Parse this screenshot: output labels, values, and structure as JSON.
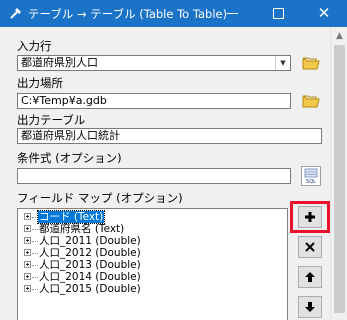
{
  "window": {
    "title": "テーブル → テーブル (Table To Table)",
    "title_bar_color": "#1a73c7",
    "minimize_icon": "minimize-icon",
    "maximize_icon": "maximize-icon",
    "close_glyph": "✕"
  },
  "form": {
    "input_rows_label": "入力行",
    "input_rows_value": "都道府県別人口",
    "output_location_label": "出力場所",
    "output_location_value": "C:¥Temp¥a.gdb",
    "output_table_label": "出力テーブル",
    "output_table_value": "都道府県別人口統計",
    "expression_label": "条件式 (オプション)",
    "expression_value": "",
    "field_map_label": "フィールド マップ (オプション)"
  },
  "field_map": {
    "items": [
      {
        "label": "コード (Text)",
        "selected": true
      },
      {
        "label": "都道府県名 (Text)",
        "selected": false
      },
      {
        "label": "人口_2011 (Double)",
        "selected": false
      },
      {
        "label": "人口_2012 (Double)",
        "selected": false
      },
      {
        "label": "人口_2013 (Double)",
        "selected": false
      },
      {
        "label": "人口_2014 (Double)",
        "selected": false
      },
      {
        "label": "人口_2015 (Double)",
        "selected": false
      }
    ]
  },
  "side_buttons": {
    "add_icon": "plus-icon",
    "remove_icon": "x-icon",
    "up_icon": "arrow-up-icon",
    "down_icon": "arrow-down-icon"
  },
  "colors": {
    "highlight_border": "#e8132b",
    "selection": "#0078d7"
  }
}
